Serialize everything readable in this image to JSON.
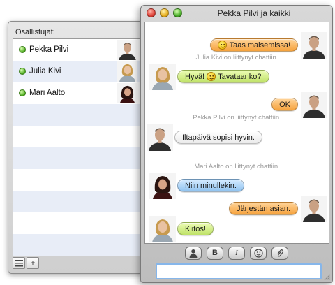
{
  "participants_panel": {
    "title": "Osallistujat:",
    "people": [
      {
        "name": "Pekka Pilvi"
      },
      {
        "name": "Julia Kivi"
      },
      {
        "name": "Mari Aalto"
      }
    ],
    "toolbar": {
      "list_icon": "list-icon",
      "add_label": "+"
    }
  },
  "chat_window": {
    "title": "Pekka Pilvi ja kaikki",
    "messages": [
      {
        "sender": "Pekka Pilvi",
        "text": "Taas maisemissa!",
        "color": "orange",
        "side": "right"
      },
      {
        "status": "Julia Kivi on liittynyt chattiin."
      },
      {
        "sender": "Julia Kivi",
        "text_before": "Hyvä!",
        "text_after": "Tavataanko?",
        "color": "green",
        "side": "left"
      },
      {
        "sender": "Pekka Pilvi",
        "text": "OK",
        "color": "orange",
        "side": "right"
      },
      {
        "status": "Pekka Pilvi on liittynyt chattiin."
      },
      {
        "sender": "Pekka Pilvi",
        "text": "Iltapäivä sopisi hyvin.",
        "color": "white",
        "side": "left"
      },
      {
        "status": "Mari Aalto on liittynyt chattiin."
      },
      {
        "sender": "Mari Aalto",
        "text": "Niin minullekin.",
        "color": "blue",
        "side": "left"
      },
      {
        "sender": "Pekka Pilvi",
        "text": "Järjestän asian.",
        "color": "orange",
        "side": "right"
      },
      {
        "sender": "Julia Kivi",
        "text": "Kiitos!",
        "color": "green",
        "side": "left"
      }
    ],
    "format_buttons": {
      "bold": "B",
      "italic": "I"
    },
    "input": {
      "value": ""
    }
  },
  "colors": {
    "orange_bubble": "#f6a23c",
    "green_bubble": "#bfe268",
    "blue_bubble": "#8fc2f0",
    "white_bubble": "#ffffff",
    "online_dot": "#4caa1e",
    "row_stripe": "#e8edf7"
  }
}
